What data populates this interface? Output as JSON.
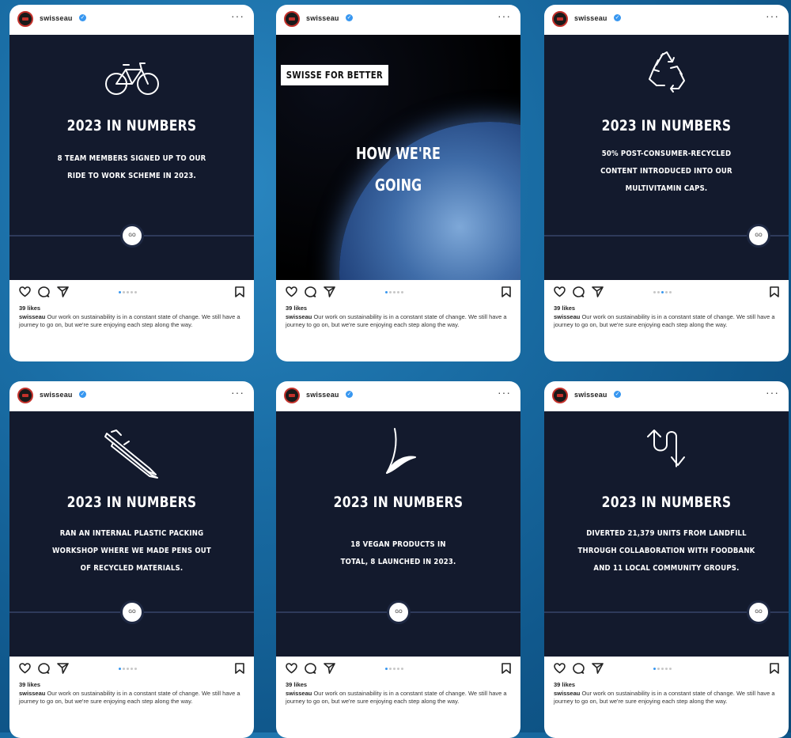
{
  "account": {
    "username": "swisseau",
    "verified_mark": "✓",
    "more_label": "···"
  },
  "posts": [
    {
      "type": "stat",
      "icon": "bicycle-icon",
      "heading": "2023 IN NUMBERS",
      "lines": [
        "8 TEAM MEMBERS SIGNED UP TO OUR",
        "RIDE TO WORK SCHEME IN 2023."
      ],
      "timeline_button": "GO",
      "likes": "39 likes",
      "caption_user": "swisseau",
      "caption_text": "Our work on sustainability is in a constant state of change. We still have a journey to go on, but we're sure enjoying each step along the way."
    },
    {
      "type": "story",
      "tag": "SWISSE FOR BETTER",
      "heading_lines": [
        "HOW WE'RE",
        "GOING"
      ],
      "likes": "39 likes",
      "caption_user": "swisseau",
      "caption_text": "Our work on sustainability is in a constant state of change. We still have a journey to go on, but we're sure enjoying each step along the way."
    },
    {
      "type": "stat",
      "icon": "recycle-icon",
      "heading": "2023 IN NUMBERS",
      "lines": [
        "50% POST-CONSUMER-RECYCLED",
        "CONTENT INTRODUCED INTO OUR",
        "MULTIVITAMIN CAPS."
      ],
      "timeline_button": "GO",
      "likes": "39 likes",
      "caption_user": "swisseau",
      "caption_text": "Our work on sustainability is in a constant state of change. We still have a journey to go on, but we're sure enjoying each step along the way."
    },
    {
      "type": "stat",
      "icon": "pens-icon",
      "heading": "2023 IN NUMBERS",
      "lines": [
        "RAN AN INTERNAL PLASTIC PACKING",
        "WORKSHOP WHERE WE MADE PENS OUT",
        "OF RECYCLED MATERIALS."
      ],
      "timeline_button": "GO",
      "likes": "39 likes",
      "caption_user": "swisseau",
      "caption_text": "Our work on sustainability is in a constant state of change. We still have a journey to go on, but we're sure enjoying each step along the way."
    },
    {
      "type": "stat",
      "icon": "leaf-icon",
      "heading": "2023 IN NUMBERS",
      "lines": [
        "18 VEGAN PRODUCTS IN",
        "TOTAL, 8 LAUNCHED IN 2023."
      ],
      "timeline_button": "GO",
      "likes": "39 likes",
      "caption_user": "swisseau",
      "caption_text": "Our work on sustainability is in a constant state of change. We still have a journey to go on, but we're sure enjoying each step along the way."
    },
    {
      "type": "stat",
      "icon": "arrows-icon",
      "heading": "2023 IN NUMBERS",
      "lines": [
        "DIVERTED 21,379 UNITS FROM LANDFILL",
        "THROUGH COLLABORATION WITH FOODBANK",
        "AND 11 LOCAL COMMUNITY GROUPS."
      ],
      "timeline_button": "GO",
      "likes": "39 likes",
      "caption_user": "swisseau",
      "caption_text": "Our work on sustainability is in a constant state of change. We still have a journey to go on, but we're sure enjoying each step along the way."
    }
  ],
  "colors": {
    "background": "#1a6ea6",
    "card_dark": "#131a2d",
    "accent": "#3897f0",
    "avatar_ring": "#c3312b"
  }
}
